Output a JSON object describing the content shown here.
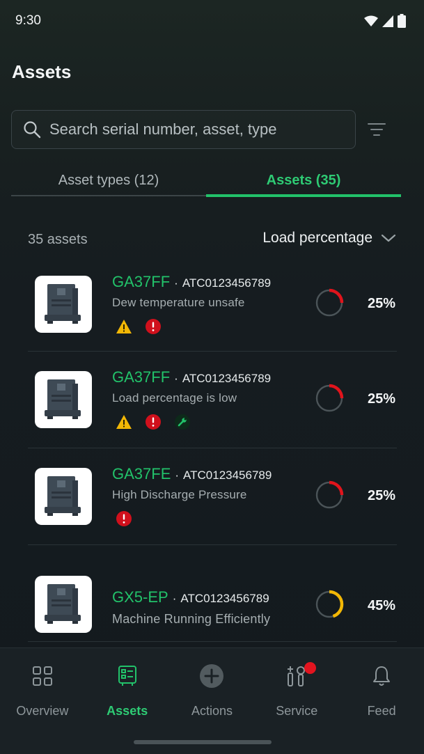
{
  "status_bar": {
    "time": "9:30"
  },
  "header": {
    "title": "Assets"
  },
  "search": {
    "placeholder": "Search serial number, asset, type"
  },
  "tabs": [
    {
      "label": "Asset types (12)",
      "active": false
    },
    {
      "label": "Assets (35)",
      "active": true
    }
  ],
  "list": {
    "count_label": "35 assets",
    "sort_label": "Load percentage",
    "items": [
      {
        "model": "GA37FF",
        "separator": "·",
        "serial": "ATC0123456789",
        "status": "Dew temperature unsafe",
        "badges": [
          "warning-icon",
          "error-icon"
        ],
        "load_percent": 25,
        "percent_label": "25%"
      },
      {
        "model": "GA37FF",
        "separator": "·",
        "serial": "ATC0123456789",
        "status": "Load percentage is low",
        "badges": [
          "warning-icon",
          "error-icon",
          "wrench-icon"
        ],
        "load_percent": 25,
        "percent_label": "25%"
      },
      {
        "model": "GA37FE",
        "separator": "·",
        "serial": "ATC0123456789",
        "status": "High Discharge Pressure",
        "badges": [
          "error-icon"
        ],
        "load_percent": 25,
        "percent_label": "25%"
      },
      {
        "model": "GX5-EP",
        "separator": "·",
        "serial": "ATC0123456789",
        "status": "Machine Running Efficiently",
        "badges": [],
        "load_percent": 45,
        "percent_label": "45%"
      }
    ]
  },
  "bottom_nav": [
    {
      "label": "Overview",
      "icon": "grid-icon",
      "active": false
    },
    {
      "label": "Assets",
      "icon": "assets-icon",
      "active": true
    },
    {
      "label": "Actions",
      "icon": "plus-circle-icon",
      "active": false
    },
    {
      "label": "Service",
      "icon": "service-icon",
      "active": false,
      "notification": true
    },
    {
      "label": "Feed",
      "icon": "bell-icon",
      "active": false
    }
  ],
  "colors": {
    "accent": "#22c26a",
    "warning": "#f2b705",
    "error": "#d0101c",
    "ring_low": "#e0141c",
    "ring_mid": "#f2b705",
    "ring_track": "#4b5458"
  }
}
